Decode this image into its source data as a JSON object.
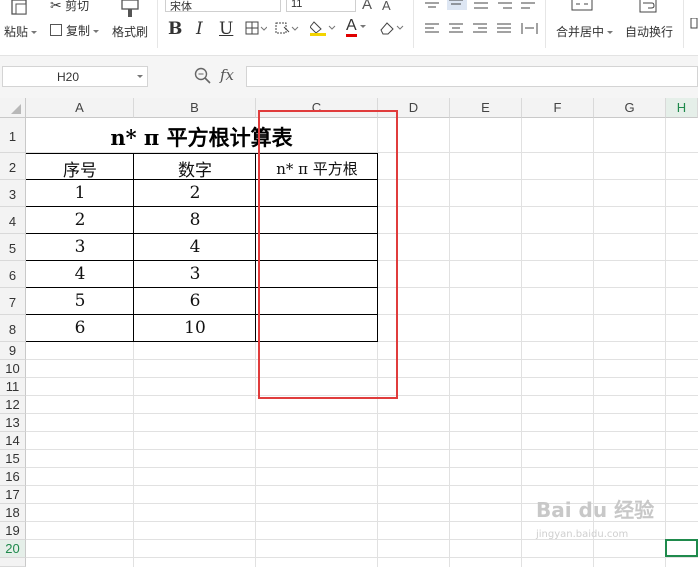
{
  "ribbon": {
    "paste_label": "粘贴",
    "cut_label": "剪切",
    "copy_label": "复制",
    "format_painter_label": "格式刷",
    "font_name": "宋体",
    "font_size": "11",
    "bold": "B",
    "italic": "I",
    "underline": "U",
    "font_color_glyph": "A",
    "merge_center_label": "合并居中",
    "wrap_text_label": "自动换行"
  },
  "formula_bar": {
    "cell_ref": "H20",
    "fx_label": "fx",
    "formula": ""
  },
  "columns": [
    "A",
    "B",
    "C",
    "D",
    "E",
    "F",
    "G",
    "H"
  ],
  "rows": [
    "1",
    "2",
    "3",
    "4",
    "5",
    "6",
    "7",
    "8",
    "9",
    "10",
    "11",
    "12",
    "13",
    "14",
    "15",
    "16",
    "17",
    "18",
    "19",
    "20"
  ],
  "sheet": {
    "title": "n* π 平方根计算表",
    "headers": [
      "序号",
      "数字",
      "n* π 平方根"
    ],
    "data": [
      [
        "1",
        "2",
        ""
      ],
      [
        "2",
        "8",
        ""
      ],
      [
        "3",
        "4",
        ""
      ],
      [
        "4",
        "3",
        ""
      ],
      [
        "5",
        "6",
        ""
      ],
      [
        "6",
        "10",
        ""
      ]
    ]
  },
  "colors": {
    "highlight_box": "#e03c3c",
    "active_cell_border": "#1f8a4c"
  },
  "watermark": {
    "brand": "Bai du 经验",
    "url": "jingyan.baidu.com"
  }
}
